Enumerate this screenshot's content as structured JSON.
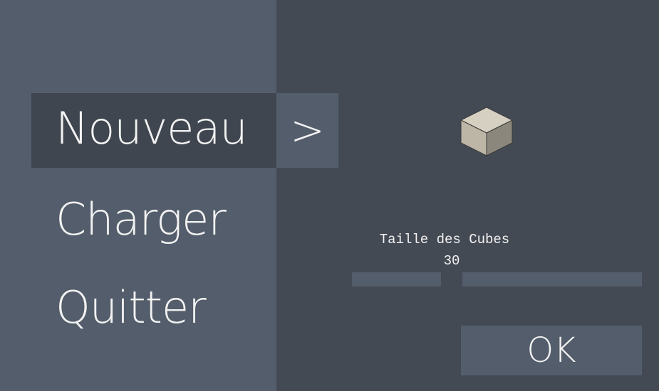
{
  "menu": {
    "items": [
      {
        "label": "Nouveau",
        "selected": true
      },
      {
        "label": "Charger",
        "selected": false
      },
      {
        "label": "Quitter",
        "selected": false
      }
    ],
    "arrow_label": ">"
  },
  "settings": {
    "cube_size_label": "Taille des Cubes",
    "cube_size_value": "30",
    "ok_label": "OK"
  },
  "icons": {
    "preview": "cube-icon"
  },
  "colors": {
    "background": "#444a54",
    "panel": "#545d6b",
    "selected": "#3f4650",
    "text": "#f2f2f2",
    "cube_top": "#d6d0c2",
    "cube_left": "#bdb6a6",
    "cube_right": "#8c877c"
  }
}
